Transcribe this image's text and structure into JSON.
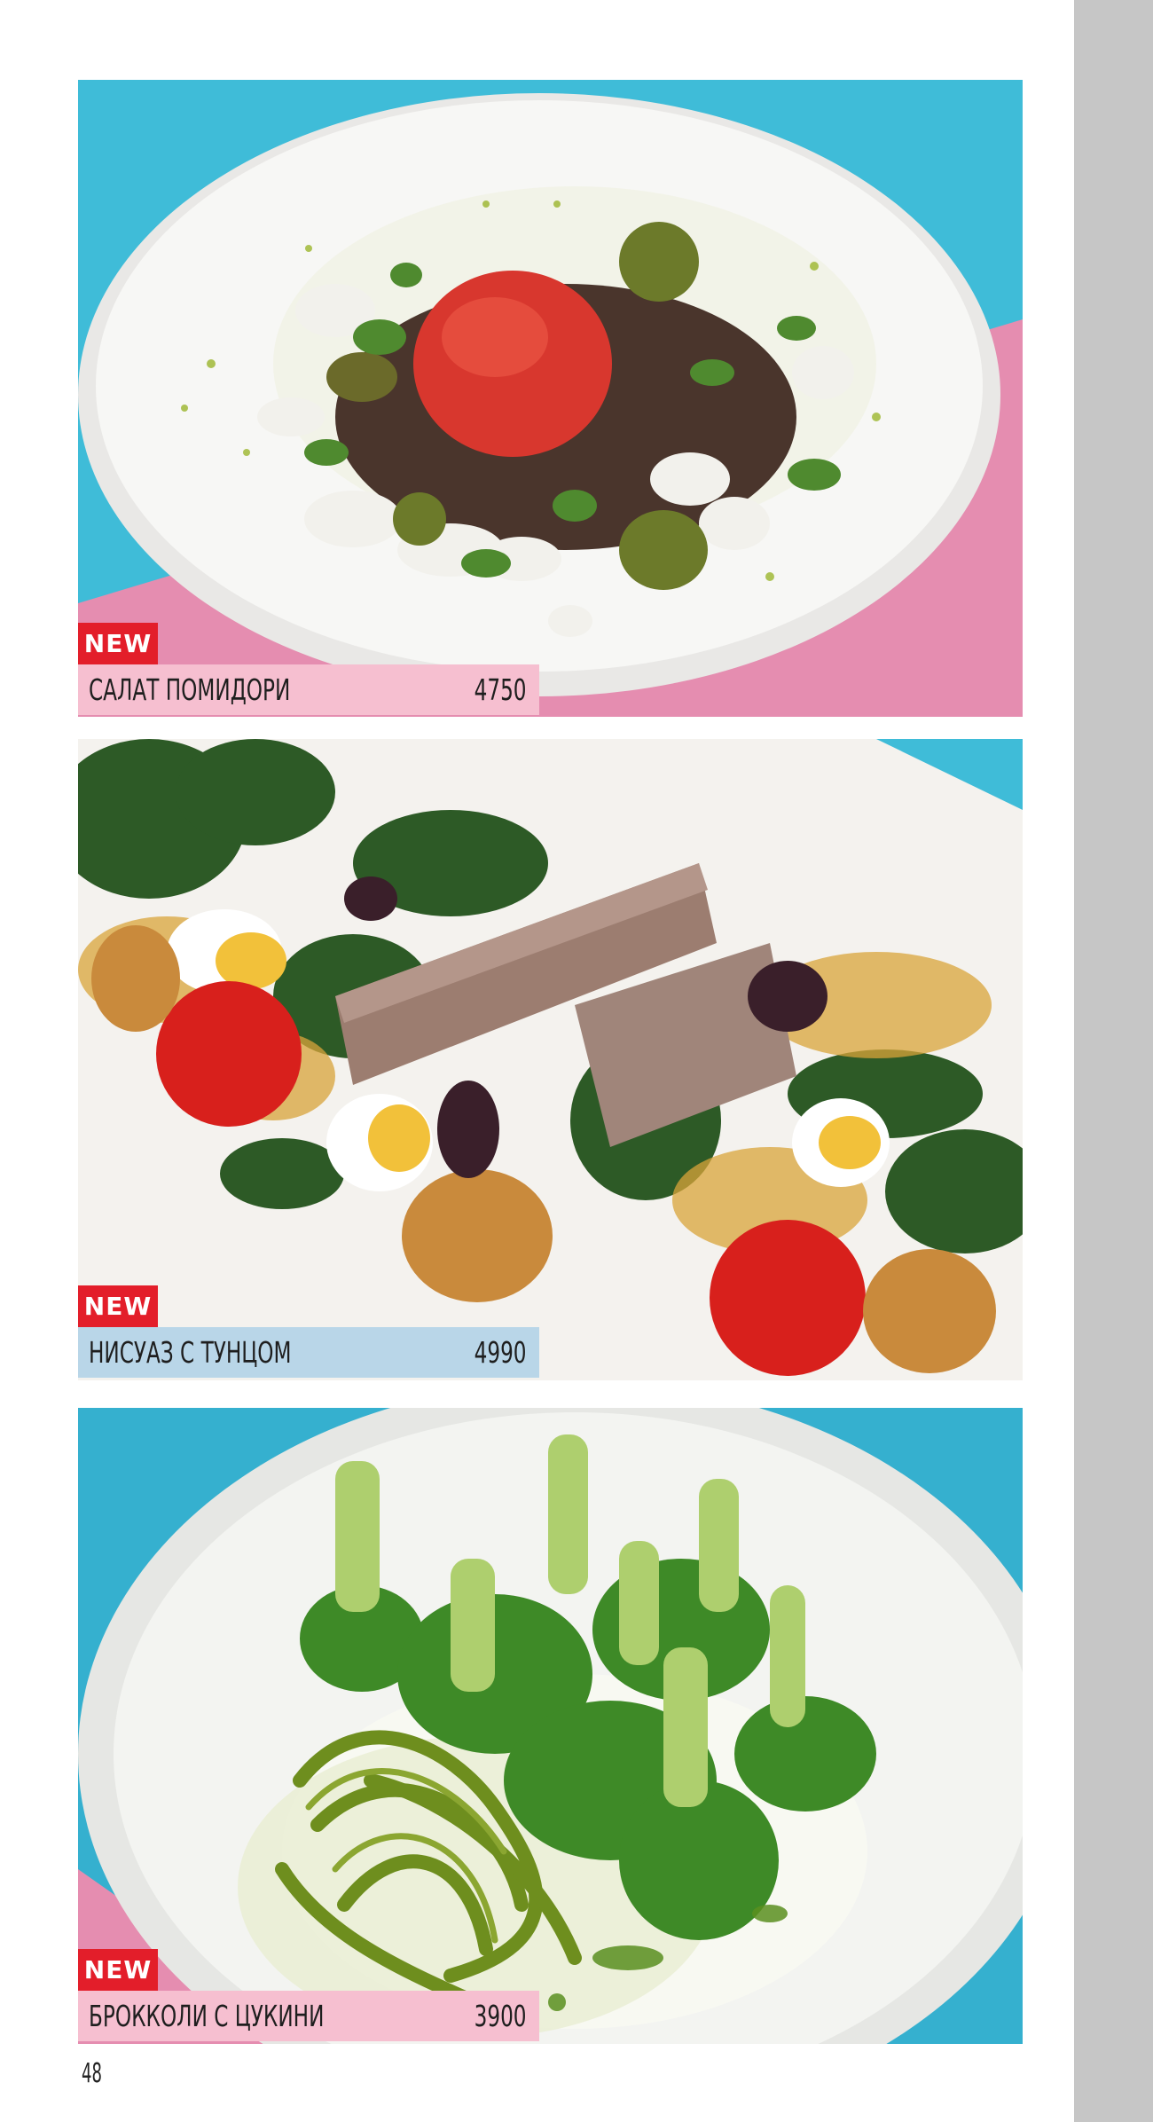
{
  "items": [
    {
      "badge": "NEW",
      "name": "САЛАТ ПОМИДОРИ",
      "price": "4750",
      "bar_color": "#f6bfd0"
    },
    {
      "badge": "NEW",
      "name": "НИСУАЗ С ТУНЦОМ",
      "price": "4990",
      "bar_color": "#b9d6e8"
    },
    {
      "badge": "NEW",
      "name": "БРОККОЛИ С ЦУКИНИ",
      "price": "3900",
      "bar_color": "#f6bfd0"
    }
  ],
  "page_number": "48",
  "colors": {
    "badge": "#e31e2a",
    "side_strip": "#c6c6c6",
    "turquoise": "#3fbcd8",
    "pink": "#e58db0"
  }
}
